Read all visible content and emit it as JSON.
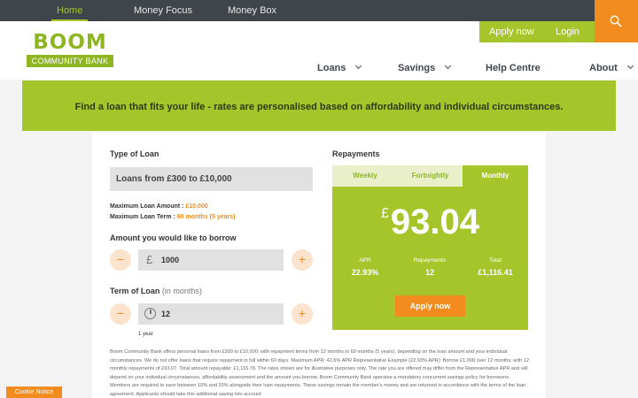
{
  "topnav": {
    "tabs": [
      "Home",
      "Money Focus",
      "Money Box"
    ],
    "active": "Home"
  },
  "header": {
    "logo_word": "BOOM",
    "logo_sub": "COMMUNITY BANK",
    "actions": {
      "apply": "Apply now",
      "login": "Login"
    },
    "search_icon": "search-icon",
    "nav": [
      "Loans",
      "Savings",
      "Help Centre",
      "About"
    ]
  },
  "banner": {
    "text": "Find a loan that fits your life - rates are personalised based on affordability and individual circumstances."
  },
  "calculator": {
    "type_label": "Type of Loan",
    "type_value": "Loans from £300 to £10,000",
    "max_amount_label": "Maximum Loan Amount :",
    "max_amount_value": "£10,000",
    "max_term_label": "Maximum Loan Term :",
    "max_term_value": "60 months (5 years)",
    "amount_label": "Amount you would like to borrow",
    "amount_prefix": "£",
    "amount_value": "1000",
    "term_label": "Term of Loan",
    "term_unit": "(in months)",
    "term_value": "12",
    "term_hint": "1 year",
    "minus": "−",
    "plus": "+"
  },
  "repayments": {
    "label": "Repayments",
    "tabs": [
      "Weekly",
      "Fortnightly",
      "Monthly"
    ],
    "active_tab": "Monthly",
    "currency": "£",
    "amount": "93.04",
    "apr_label": "APR",
    "apr_value": "22.93%",
    "count_label": "Repayments",
    "count_value": "12",
    "total_label": "Total",
    "total_value": "£1,116.41",
    "apply_label": "Apply now"
  },
  "disclaimer": "Boom Community Bank offers personal loans from £300 to £10,000, with repayment terms from 12 months to 60 months (5 years), depending on the loan amount and your individual circumstances. We do not offer loans that require repayment in full within 60 days. Maximum APR: 42.6% APR Representative Example (22.93% APR): Borrow £1,000 over 12 months, with 12 monthly repayments of £93.07. Total amount repayable: £1,116.78. The rates shown are for illustrative purposes only. The rate you are offered may differ from the Representative APR and will depend on your individual circumstances, affordability assessment and the amount you borrow. Boom Community Bank operates a mandatory concurrent savings policy for borrowers. Members are required to save between 10% and 20% alongside their loan repayments. These savings remain the member's money and are returned in accordance with the terms of the loan agreement. Applicants should take this additional saving into account",
  "cookie_notice": "Cookie Notice",
  "colors": {
    "accent_green": "#a6c52a",
    "accent_orange": "#f28c1e",
    "dark": "#3f454b"
  }
}
